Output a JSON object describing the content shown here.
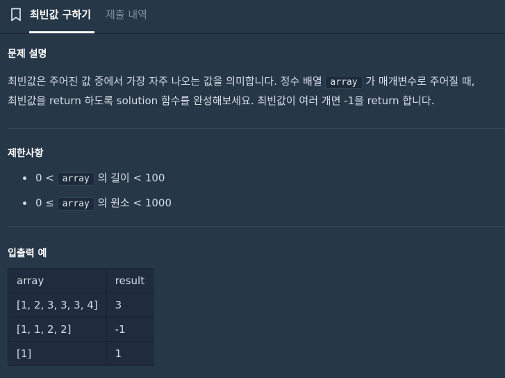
{
  "tabs": [
    {
      "label": "최빈값 구하기",
      "active": true
    },
    {
      "label": "제출 내역",
      "active": false
    }
  ],
  "description": {
    "heading": "문제 설명",
    "line1_pre": "최빈값은 주어진 값 중에서 가장 자주 나오는 값을 의미합니다. 정수 배열 ",
    "line1_code": "array",
    "line1_post": " 가 매개변수로 주어질 때,",
    "line2": "최빈값을 return 하도록 solution 함수를 완성해보세요. 최빈값이 여러 개면 -1을 return 합니다."
  },
  "constraints": {
    "heading": "제한사항",
    "items": [
      {
        "pre": "0 < ",
        "code": "array",
        "post": " 의 길이 < 100"
      },
      {
        "pre": "0 ≤ ",
        "code": "array",
        "post": " 의 원소 < 1000"
      }
    ]
  },
  "examples": {
    "heading": "입출력 예",
    "columns": [
      "array",
      "result"
    ],
    "rows": [
      [
        "[1, 2, 3, 3, 3, 4]",
        "3"
      ],
      [
        "[1, 1, 2, 2]",
        "-1"
      ],
      [
        "[1]",
        "1"
      ]
    ]
  },
  "colors": {
    "background": "#263747",
    "table_background": "#202b3d",
    "active_tab": "#ffffff",
    "inactive_tab": "#78909c"
  }
}
